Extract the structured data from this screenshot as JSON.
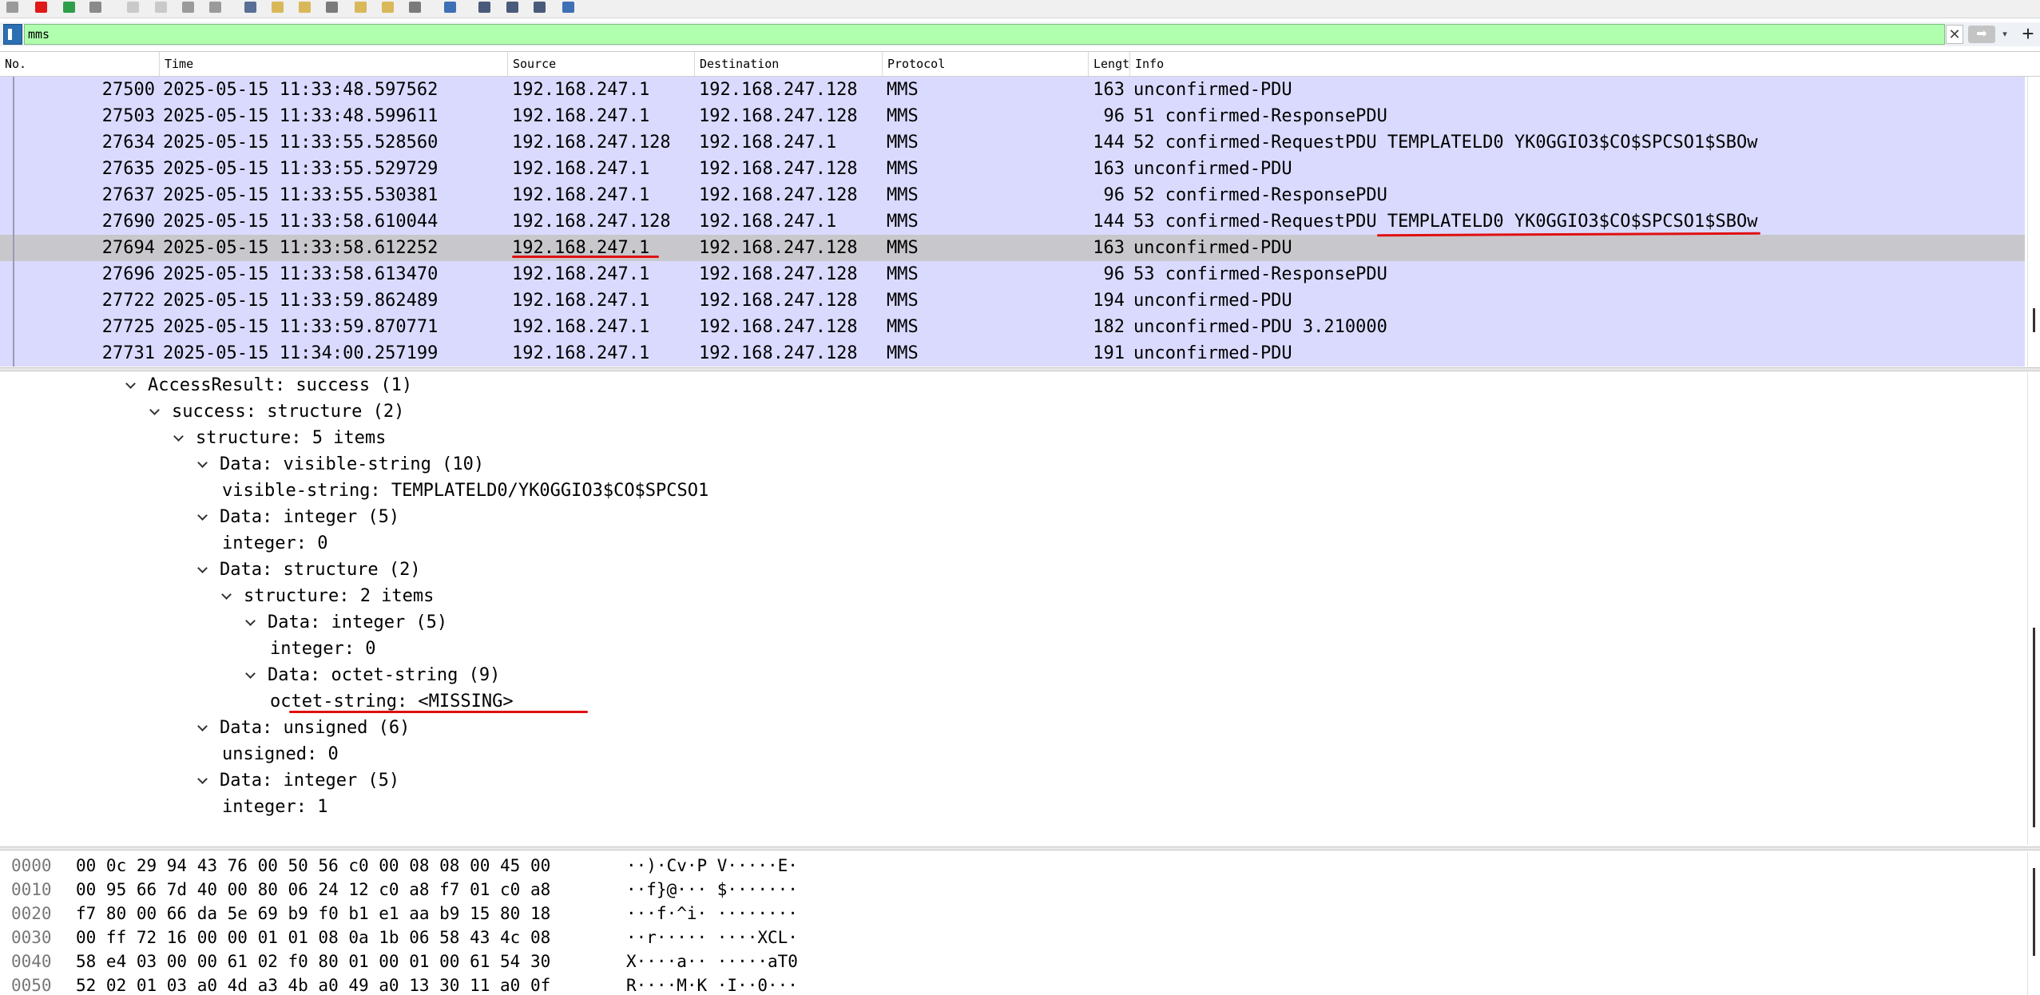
{
  "toolbar": {
    "buttons": [
      {
        "name": "shark-fin-start-icon",
        "color": "#9a9a9a"
      },
      {
        "name": "stop-capture-icon",
        "color": "#e01818"
      },
      {
        "name": "restart-capture-icon",
        "color": "#2e9e4a"
      },
      {
        "name": "capture-options-icon",
        "color": "#8a8a8a"
      },
      {
        "name": "open-file-icon",
        "color": "#c9c9c9"
      },
      {
        "name": "save-file-icon",
        "color": "#c9c9c9"
      },
      {
        "name": "close-file-icon",
        "color": "#9a9a9a"
      },
      {
        "name": "reload-file-icon",
        "color": "#9a9a9a"
      },
      {
        "name": "find-packet-icon",
        "color": "#5a6f95"
      },
      {
        "name": "go-back-icon",
        "color": "#d9b85a"
      },
      {
        "name": "go-forward-icon",
        "color": "#d9b85a"
      },
      {
        "name": "go-to-packet-icon",
        "color": "#7a7a7a"
      },
      {
        "name": "go-first-packet-icon",
        "color": "#d9b85a"
      },
      {
        "name": "go-last-packet-icon",
        "color": "#d9b85a"
      },
      {
        "name": "auto-scroll-icon",
        "color": "#7a7a7a"
      },
      {
        "name": "colorize-icon",
        "color": "#3f6fb5"
      },
      {
        "name": "zoom-in-icon",
        "color": "#4a5a7a"
      },
      {
        "name": "zoom-out-icon",
        "color": "#4a5a7a"
      },
      {
        "name": "normal-size-icon",
        "color": "#4a5a7a"
      },
      {
        "name": "resize-columns-icon",
        "color": "#3f6fb5"
      }
    ]
  },
  "filter": {
    "value": "mms",
    "clear_glyph": "✕",
    "apply_glyph": "➡",
    "dropdown_glyph": "▾",
    "add_glyph": "+",
    "bg_color": "#afffaf"
  },
  "packet_list": {
    "columns": [
      "No.",
      "Time",
      "Source",
      "Destination",
      "Protocol",
      "Lengt",
      "Info"
    ],
    "row_color": "#dadaff",
    "selected_color": "#c8c8cc",
    "rows": [
      {
        "no": "27500",
        "time": "2025-05-15 11:33:48.597562",
        "src": "192.168.247.1",
        "dst": "192.168.247.128",
        "proto": "MMS",
        "len": "163",
        "info": "unconfirmed-PDU"
      },
      {
        "no": "27503",
        "time": "2025-05-15 11:33:48.599611",
        "src": "192.168.247.1",
        "dst": "192.168.247.128",
        "proto": "MMS",
        "len": "96",
        "info": "51 confirmed-ResponsePDU"
      },
      {
        "no": "27634",
        "time": "2025-05-15 11:33:55.528560",
        "src": "192.168.247.128",
        "dst": "192.168.247.1",
        "proto": "MMS",
        "len": "144",
        "info": "52 confirmed-RequestPDU TEMPLATELD0 YK0GGIO3$CO$SPCSO1$SBOw"
      },
      {
        "no": "27635",
        "time": "2025-05-15 11:33:55.529729",
        "src": "192.168.247.1",
        "dst": "192.168.247.128",
        "proto": "MMS",
        "len": "163",
        "info": "unconfirmed-PDU"
      },
      {
        "no": "27637",
        "time": "2025-05-15 11:33:55.530381",
        "src": "192.168.247.1",
        "dst": "192.168.247.128",
        "proto": "MMS",
        "len": "96",
        "info": "52 confirmed-ResponsePDU"
      },
      {
        "no": "27690",
        "time": "2025-05-15 11:33:58.610044",
        "src": "192.168.247.128",
        "dst": "192.168.247.1",
        "proto": "MMS",
        "len": "144",
        "info": "53 confirmed-RequestPDU TEMPLATELD0 YK0GGIO3$CO$SPCSO1$SBOw"
      },
      {
        "no": "27694",
        "time": "2025-05-15 11:33:58.612252",
        "src": "192.168.247.1",
        "dst": "192.168.247.128",
        "proto": "MMS",
        "len": "163",
        "info": "unconfirmed-PDU",
        "selected": true
      },
      {
        "no": "27696",
        "time": "2025-05-15 11:33:58.613470",
        "src": "192.168.247.1",
        "dst": "192.168.247.128",
        "proto": "MMS",
        "len": "96",
        "info": "53 confirmed-ResponsePDU"
      },
      {
        "no": "27722",
        "time": "2025-05-15 11:33:59.862489",
        "src": "192.168.247.1",
        "dst": "192.168.247.128",
        "proto": "MMS",
        "len": "194",
        "info": "unconfirmed-PDU"
      },
      {
        "no": "27725",
        "time": "2025-05-15 11:33:59.870771",
        "src": "192.168.247.1",
        "dst": "192.168.247.128",
        "proto": "MMS",
        "len": "182",
        "info": "unconfirmed-PDU 3.210000"
      },
      {
        "no": "27731",
        "time": "2025-05-15 11:34:00.257199",
        "src": "192.168.247.1",
        "dst": "192.168.247.128",
        "proto": "MMS",
        "len": "191",
        "info": "unconfirmed-PDU"
      }
    ]
  },
  "details_tree": [
    {
      "label": "AccessResult: success (1)",
      "depth": 0,
      "expanded": true
    },
    {
      "label": "success: structure (2)",
      "depth": 1,
      "expanded": true
    },
    {
      "label": "structure: 5 items",
      "depth": 2,
      "expanded": true
    },
    {
      "label": "Data: visible-string (10)",
      "depth": 3,
      "expanded": true
    },
    {
      "label": "visible-string: TEMPLATELD0/YK0GGIO3$CO$SPCSO1",
      "depth": 4,
      "expanded": null
    },
    {
      "label": "Data: integer (5)",
      "depth": 3,
      "expanded": true
    },
    {
      "label": "integer: 0",
      "depth": 4,
      "expanded": null
    },
    {
      "label": "Data: structure (2)",
      "depth": 3,
      "expanded": true
    },
    {
      "label": "structure: 2 items",
      "depth": 4,
      "expanded": true
    },
    {
      "label": "Data: integer (5)",
      "depth": 5,
      "expanded": true
    },
    {
      "label": "integer: 0",
      "depth": 6,
      "expanded": null
    },
    {
      "label": "Data: octet-string (9)",
      "depth": 5,
      "expanded": true
    },
    {
      "label": "octet-string: <MISSING>",
      "depth": 6,
      "expanded": null
    },
    {
      "label": "Data: unsigned (6)",
      "depth": 3,
      "expanded": true
    },
    {
      "label": "unsigned: 0",
      "depth": 4,
      "expanded": null
    },
    {
      "label": "Data: integer (5)",
      "depth": 3,
      "expanded": true
    },
    {
      "label": "integer: 1",
      "depth": 4,
      "expanded": null
    }
  ],
  "bytes": [
    {
      "offset": "0000",
      "hex": "00 0c 29 94 43 76 00 50  56 c0 00 08 08 00 45 00",
      "ascii": "··)·Cv·P V·····E·"
    },
    {
      "offset": "0010",
      "hex": "00 95 66 7d 40 00 80 06  24 12 c0 a8 f7 01 c0 a8",
      "ascii": "··f}@··· $·······"
    },
    {
      "offset": "0020",
      "hex": "f7 80 00 66 da 5e 69 b9  f0 b1 e1 aa b9 15 80 18",
      "ascii": "···f·^i· ········"
    },
    {
      "offset": "0030",
      "hex": "00 ff 72 16 00 00 01 01  08 0a 1b 06 58 43 4c 08",
      "ascii": "··r····· ····XCL·"
    },
    {
      "offset": "0040",
      "hex": "58 e4 03 00 00 61 02 f0  80 01 00 01 00 61 54 30",
      "ascii": "X····a·· ·····aT0"
    },
    {
      "offset": "0050",
      "hex": "52 02 01 03 a0 4d a3 4b  a0 49 a0 13 30 11 a0 0f",
      "ascii": "R····M·K ·I··0···"
    }
  ],
  "annotation_color": "#e01010"
}
